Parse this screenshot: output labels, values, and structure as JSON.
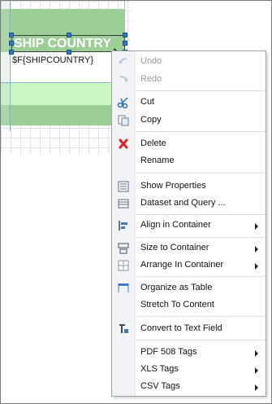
{
  "canvas": {
    "header_field_text": "SHIP COUNTRY",
    "expression_field_text": "$F{SHIPCOUNTRY}"
  },
  "context_menu": {
    "items": [
      {
        "label": "Undo",
        "icon": "undo-icon",
        "enabled": false,
        "submenu": false
      },
      {
        "label": "Redo",
        "icon": "redo-icon",
        "enabled": false,
        "submenu": false
      },
      {
        "label": "Cut",
        "icon": "scissors-icon",
        "enabled": true,
        "submenu": false
      },
      {
        "label": "Copy",
        "icon": "copy-icon",
        "enabled": true,
        "submenu": false
      },
      {
        "label": "Delete",
        "icon": "delete-x-icon",
        "enabled": true,
        "submenu": false
      },
      {
        "label": "Rename",
        "icon": "",
        "enabled": true,
        "submenu": false
      },
      {
        "label": "Show Properties",
        "icon": "properties-icon",
        "enabled": true,
        "submenu": false
      },
      {
        "label": "Dataset and Query ...",
        "icon": "dataset-icon",
        "enabled": true,
        "submenu": false
      },
      {
        "label": "Align in Container",
        "icon": "align-icon",
        "enabled": true,
        "submenu": true
      },
      {
        "label": "Size to Container",
        "icon": "size-icon",
        "enabled": true,
        "submenu": true
      },
      {
        "label": "Arrange In Container",
        "icon": "arrange-icon",
        "enabled": true,
        "submenu": true
      },
      {
        "label": "Organize as Table",
        "icon": "table-icon",
        "enabled": true,
        "submenu": false
      },
      {
        "label": "Stretch To Content",
        "icon": "",
        "enabled": true,
        "submenu": false
      },
      {
        "label": "Convert to Text Field",
        "icon": "convert-icon",
        "enabled": true,
        "submenu": false
      },
      {
        "label": "PDF 508 Tags",
        "icon": "",
        "enabled": true,
        "submenu": true
      },
      {
        "label": "XLS Tags",
        "icon": "",
        "enabled": true,
        "submenu": true
      },
      {
        "label": "CSV Tags",
        "icon": "",
        "enabled": true,
        "submenu": true
      }
    ]
  },
  "colors": {
    "band_green": "#9ccf96",
    "band_light_green": "#c9f7c3",
    "selection_handle": "#2f78c4",
    "delete_red": "#d9262b"
  }
}
